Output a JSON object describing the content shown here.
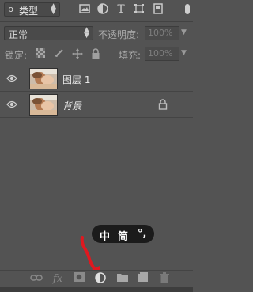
{
  "filter": {
    "kind_label": "类型",
    "kind_glyph": "ρ",
    "icons": [
      "image-filter-icon",
      "adjustment-filter-icon",
      "type-filter-icon",
      "shape-filter-icon",
      "smart-object-filter-icon"
    ],
    "type_glyph": "T"
  },
  "blend": {
    "mode": "正常",
    "opacity_label": "不透明度:",
    "opacity_value": "100%"
  },
  "lock": {
    "label": "锁定:",
    "fill_label": "填充:",
    "fill_value": "100%"
  },
  "layers": [
    {
      "name": "图层 1",
      "visible": true,
      "locked": false,
      "italic": false
    },
    {
      "name": "背景",
      "visible": true,
      "locked": true,
      "italic": true
    }
  ],
  "tooltip": {
    "char1": "中",
    "char2": "简",
    "char3": "°,"
  },
  "bottom_icons": [
    "link-layers-icon",
    "fx-icon",
    "add-mask-icon",
    "new-adjustment-layer-icon",
    "new-group-icon",
    "new-layer-icon",
    "delete-layer-icon"
  ],
  "bottom_fx_label": "fx",
  "colors": {
    "panel_bg": "#535353",
    "tooltip_bg": "#1b1b1b",
    "arrow_red": "#e0181f"
  }
}
